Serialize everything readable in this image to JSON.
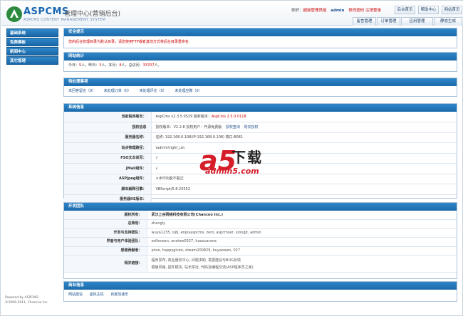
{
  "header": {
    "logo_text": "ASPCMS",
    "logo_subtitle": "管理中心(营销后台)",
    "logo_tagline": "ASPCMS CONTENT MANAGEMENT SYSTEM",
    "greeting": "你好：",
    "role": "超级管理员组",
    "username": "admin",
    "change_password": "修改密码",
    "logout": "注销登录",
    "top_buttons": [
      "后台首页",
      "帮助中心",
      "网站首页"
    ],
    "nav_tabs": [
      "留言管理",
      "订单管理",
      "应用管理",
      "静态生成"
    ]
  },
  "sidebar": {
    "items": [
      "基础系统",
      "免费模板",
      "新闻中心",
      "其它管理"
    ],
    "footer_line1": "Powered by ASPCMS!",
    "footer_line2": "©2006-2011, Chancoo Inc."
  },
  "security": {
    "title": "安全提示",
    "message": "您的后台管理目录为默认目录，请您使用FTP或者其他方式将后台目录重命名"
  },
  "stats": {
    "title": "网站统计",
    "today_label": "今日：",
    "today_value": "5",
    "yesterday_label": "人，昨日：",
    "yesterday_value": "3",
    "month_label": "人，本月：",
    "month_value": "8",
    "total_label": "人，总访问：",
    "total_value": "33707",
    "end": "人。"
  },
  "pending": {
    "title": "待处理事项",
    "items": [
      "未回答留言（0）",
      "未处理订单（0）",
      "未处理评论（0）",
      "未处理应聘（0）"
    ]
  },
  "system": {
    "title": "系统信息",
    "rows": [
      {
        "label": "当前程序版本：",
        "value": "AspCms v2.3.5 0529 最新版本：",
        "extra": "AspCms 2.5.0 0118"
      },
      {
        "label": "授权信息",
        "value": "授权版本：V2.2.8   授权用户：开源免费版",
        "links": [
          "授权查询",
          "购买授权"
        ]
      },
      {
        "label": "服务器名称：",
        "value": "名称: 192.168.0.108(IP:192.168.0.108) 端口:8081"
      },
      {
        "label": "站点物理路径：",
        "value": "\\admin\\right_us\\"
      },
      {
        "label": "FSO文本读写：",
        "value": "√"
      },
      {
        "label": "JMail组件：",
        "value": "√"
      },
      {
        "label": "ASPJpeg组件：",
        "value": "×水印功能不能正"
      },
      {
        "label": "脚本解释引擎：",
        "value": "VBScript/5.8.23552"
      },
      {
        "label": "服务器IIS版本：",
        "value": ""
      }
    ]
  },
  "team": {
    "title": "开发团队",
    "rows": [
      {
        "label": "版权所有：",
        "value": "武汉上谷网络科技有限公司(Chancoo Inc.)"
      },
      {
        "label": "总策划：",
        "value": "zhangly"
      },
      {
        "label": "开发与支持团队：",
        "value": "wuya1235, lsjtj, enjoyaspcms, zero, aspcmser, xiongjt, admin"
      },
      {
        "label": "界面与用户体验团队：",
        "value": "softocean, onetwo0327, haoxuanma"
      },
      {
        "label": "感谢贡献者：",
        "value": "phso, happygiven, dream200829, huyaowen, 027"
      },
      {
        "label": "相关链接：",
        "value": "程序发布, 商业服务中心, 问题求助, 发展建议与BUG反馈",
        "value2": "模版风格, 插件模块, 站长茶社, 代码及编程交流(ASP程序员之家)"
      }
    ]
  },
  "business": {
    "title": "商业信息",
    "links": [
      "网站建设",
      "虚拟主机",
      "百度加速乐"
    ]
  },
  "watermark": {
    "big": "a5",
    "cn": "下载",
    "url": "admin5.com"
  },
  "colors": {
    "accent": "#1b6aab",
    "alert": "#cc0000",
    "brand": "#1a66b1"
  }
}
